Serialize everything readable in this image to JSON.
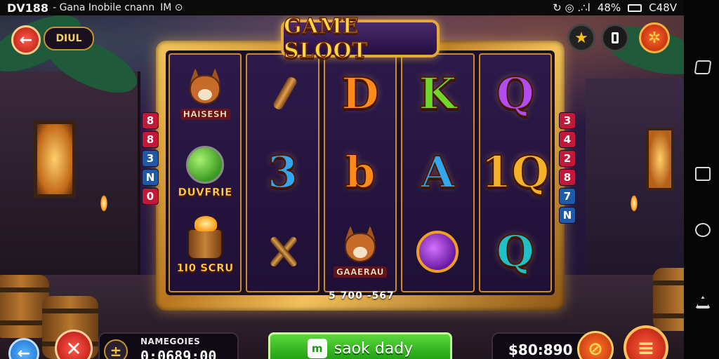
{
  "status_bar": {
    "app_id": "DV188",
    "title": "- Gana Inobile cnann",
    "title_suffix": "IM ⊙",
    "right_icons": "↻  ◎ .∴l",
    "battery": "48%",
    "carrier": "C48V"
  },
  "game": {
    "title": "GAME SLOOT",
    "top_label": "DIUL",
    "win_line": "5 700 -567",
    "left_numbers": [
      {
        "text": "8",
        "color": "#c2183a"
      },
      {
        "text": "8",
        "color": "#c2183a"
      },
      {
        "text": "3",
        "color": "#1f5aa8"
      },
      {
        "text": "N",
        "color": "#1f5aa8"
      },
      {
        "text": "0",
        "color": "#c2183a"
      }
    ],
    "right_numbers": [
      {
        "text": "3",
        "color": "#c2183a"
      },
      {
        "text": "4",
        "color": "#c2183a"
      },
      {
        "text": "2",
        "color": "#c2183a"
      },
      {
        "text": "8",
        "color": "#c2183a"
      },
      {
        "text": "7",
        "color": "#1f5aa8"
      },
      {
        "text": "N",
        "color": "#1f5aa8"
      }
    ],
    "reels": [
      [
        {
          "kind": "dog",
          "caption": "HAISESH",
          "name": "dog-symbol"
        },
        {
          "kind": "ball",
          "caption": "DUVFRIE",
          "name": "melon-club-symbol"
        },
        {
          "kind": "bucket",
          "caption": "1I0 SCRU",
          "name": "bucket-symbol"
        }
      ],
      [
        {
          "kind": "club",
          "name": "club-symbol"
        },
        {
          "kind": "glyph",
          "text": "3",
          "color": "g-blue",
          "name": "three-symbol"
        },
        {
          "kind": "cross",
          "name": "crossed-bats-symbol"
        }
      ],
      [
        {
          "kind": "glyph",
          "text": "D",
          "color": "g-orange",
          "name": "letter-d-symbol"
        },
        {
          "kind": "glyph",
          "text": "b",
          "color": "g-orange",
          "name": "letter-b-symbol"
        },
        {
          "kind": "dog",
          "caption": "GAAERAU",
          "name": "dog-symbol"
        }
      ],
      [
        {
          "kind": "glyph",
          "text": "K",
          "color": "g-green",
          "name": "letter-k-symbol"
        },
        {
          "kind": "glyph",
          "text": "A",
          "color": "g-blue",
          "name": "letter-a-symbol"
        },
        {
          "kind": "orb",
          "name": "orb-symbol"
        }
      ],
      [
        {
          "kind": "glyph",
          "text": "Q",
          "color": "g-purple",
          "name": "letter-q-symbol"
        },
        {
          "kind": "glyph",
          "text": "1Q",
          "color": "g-gold",
          "name": "ten-symbol"
        },
        {
          "kind": "glyph",
          "text": "Q",
          "color": "g-teal",
          "name": "letter-q-symbol"
        }
      ]
    ]
  },
  "bottom": {
    "info_label": "NAMEGOIES",
    "info_value": "0:0689:00",
    "spin_icon": "m",
    "spin_label": "saok dady",
    "balance": "$80:890"
  }
}
